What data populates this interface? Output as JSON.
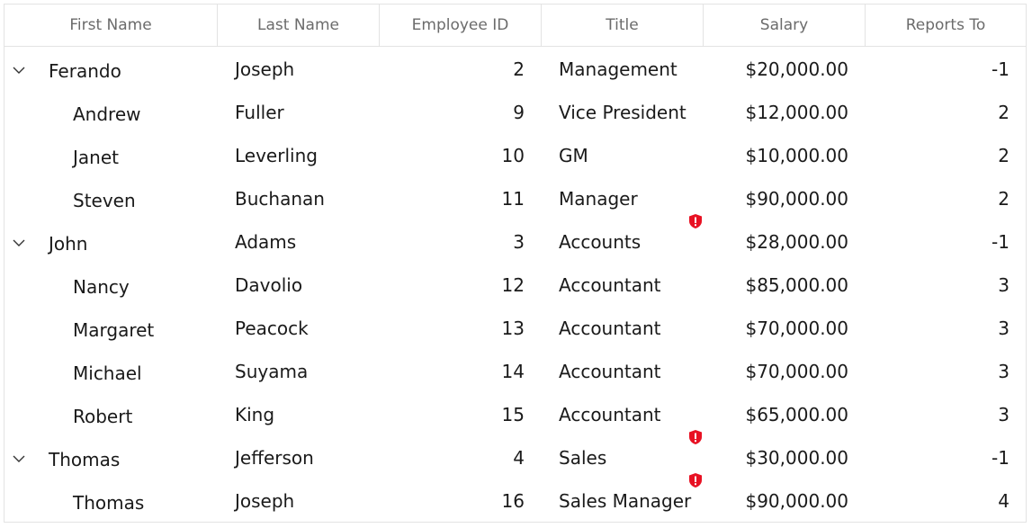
{
  "columns": [
    "First Name",
    "Last Name",
    "Employee ID",
    "Title",
    "Salary",
    "Reports To"
  ],
  "rows": [
    {
      "level": 0,
      "expandable": true,
      "first": "Ferando",
      "last": "Joseph",
      "id": "2",
      "title": "Management",
      "salary": "$20,000.00",
      "reports": "-1",
      "error": false
    },
    {
      "level": 1,
      "expandable": false,
      "first": "Andrew",
      "last": "Fuller",
      "id": "9",
      "title": "Vice President",
      "salary": "$12,000.00",
      "reports": "2",
      "error": false
    },
    {
      "level": 1,
      "expandable": false,
      "first": "Janet",
      "last": "Leverling",
      "id": "10",
      "title": "GM",
      "salary": "$10,000.00",
      "reports": "2",
      "error": false
    },
    {
      "level": 1,
      "expandable": false,
      "first": "Steven",
      "last": "Buchanan",
      "id": "11",
      "title": "Manager",
      "salary": "$90,000.00",
      "reports": "2",
      "error": false
    },
    {
      "level": 0,
      "expandable": true,
      "first": "John",
      "last": "Adams",
      "id": "3",
      "title": "Accounts",
      "salary": "$28,000.00",
      "reports": "-1",
      "error": true
    },
    {
      "level": 1,
      "expandable": false,
      "first": "Nancy",
      "last": "Davolio",
      "id": "12",
      "title": "Accountant",
      "salary": "$85,000.00",
      "reports": "3",
      "error": false
    },
    {
      "level": 1,
      "expandable": false,
      "first": "Margaret",
      "last": "Peacock",
      "id": "13",
      "title": "Accountant",
      "salary": "$70,000.00",
      "reports": "3",
      "error": false
    },
    {
      "level": 1,
      "expandable": false,
      "first": "Michael",
      "last": "Suyama",
      "id": "14",
      "title": "Accountant",
      "salary": "$70,000.00",
      "reports": "3",
      "error": false
    },
    {
      "level": 1,
      "expandable": false,
      "first": "Robert",
      "last": "King",
      "id": "15",
      "title": "Accountant",
      "salary": "$65,000.00",
      "reports": "3",
      "error": false
    },
    {
      "level": 0,
      "expandable": true,
      "first": "Thomas",
      "last": "Jefferson",
      "id": "4",
      "title": "Sales",
      "salary": "$30,000.00",
      "reports": "-1",
      "error": true
    },
    {
      "level": 1,
      "expandable": false,
      "first": "Thomas",
      "last": "Joseph",
      "id": "16",
      "title": "Sales Manager",
      "salary": "$90,000.00",
      "reports": "4",
      "error": true
    }
  ],
  "icons": {
    "expander": "chevron-down-icon",
    "error": "error-shield-icon"
  },
  "colors": {
    "error": "#e81123",
    "border": "#e3e3e3",
    "header_text": "#6b6b6b",
    "cell_text": "#1a1a1a"
  }
}
